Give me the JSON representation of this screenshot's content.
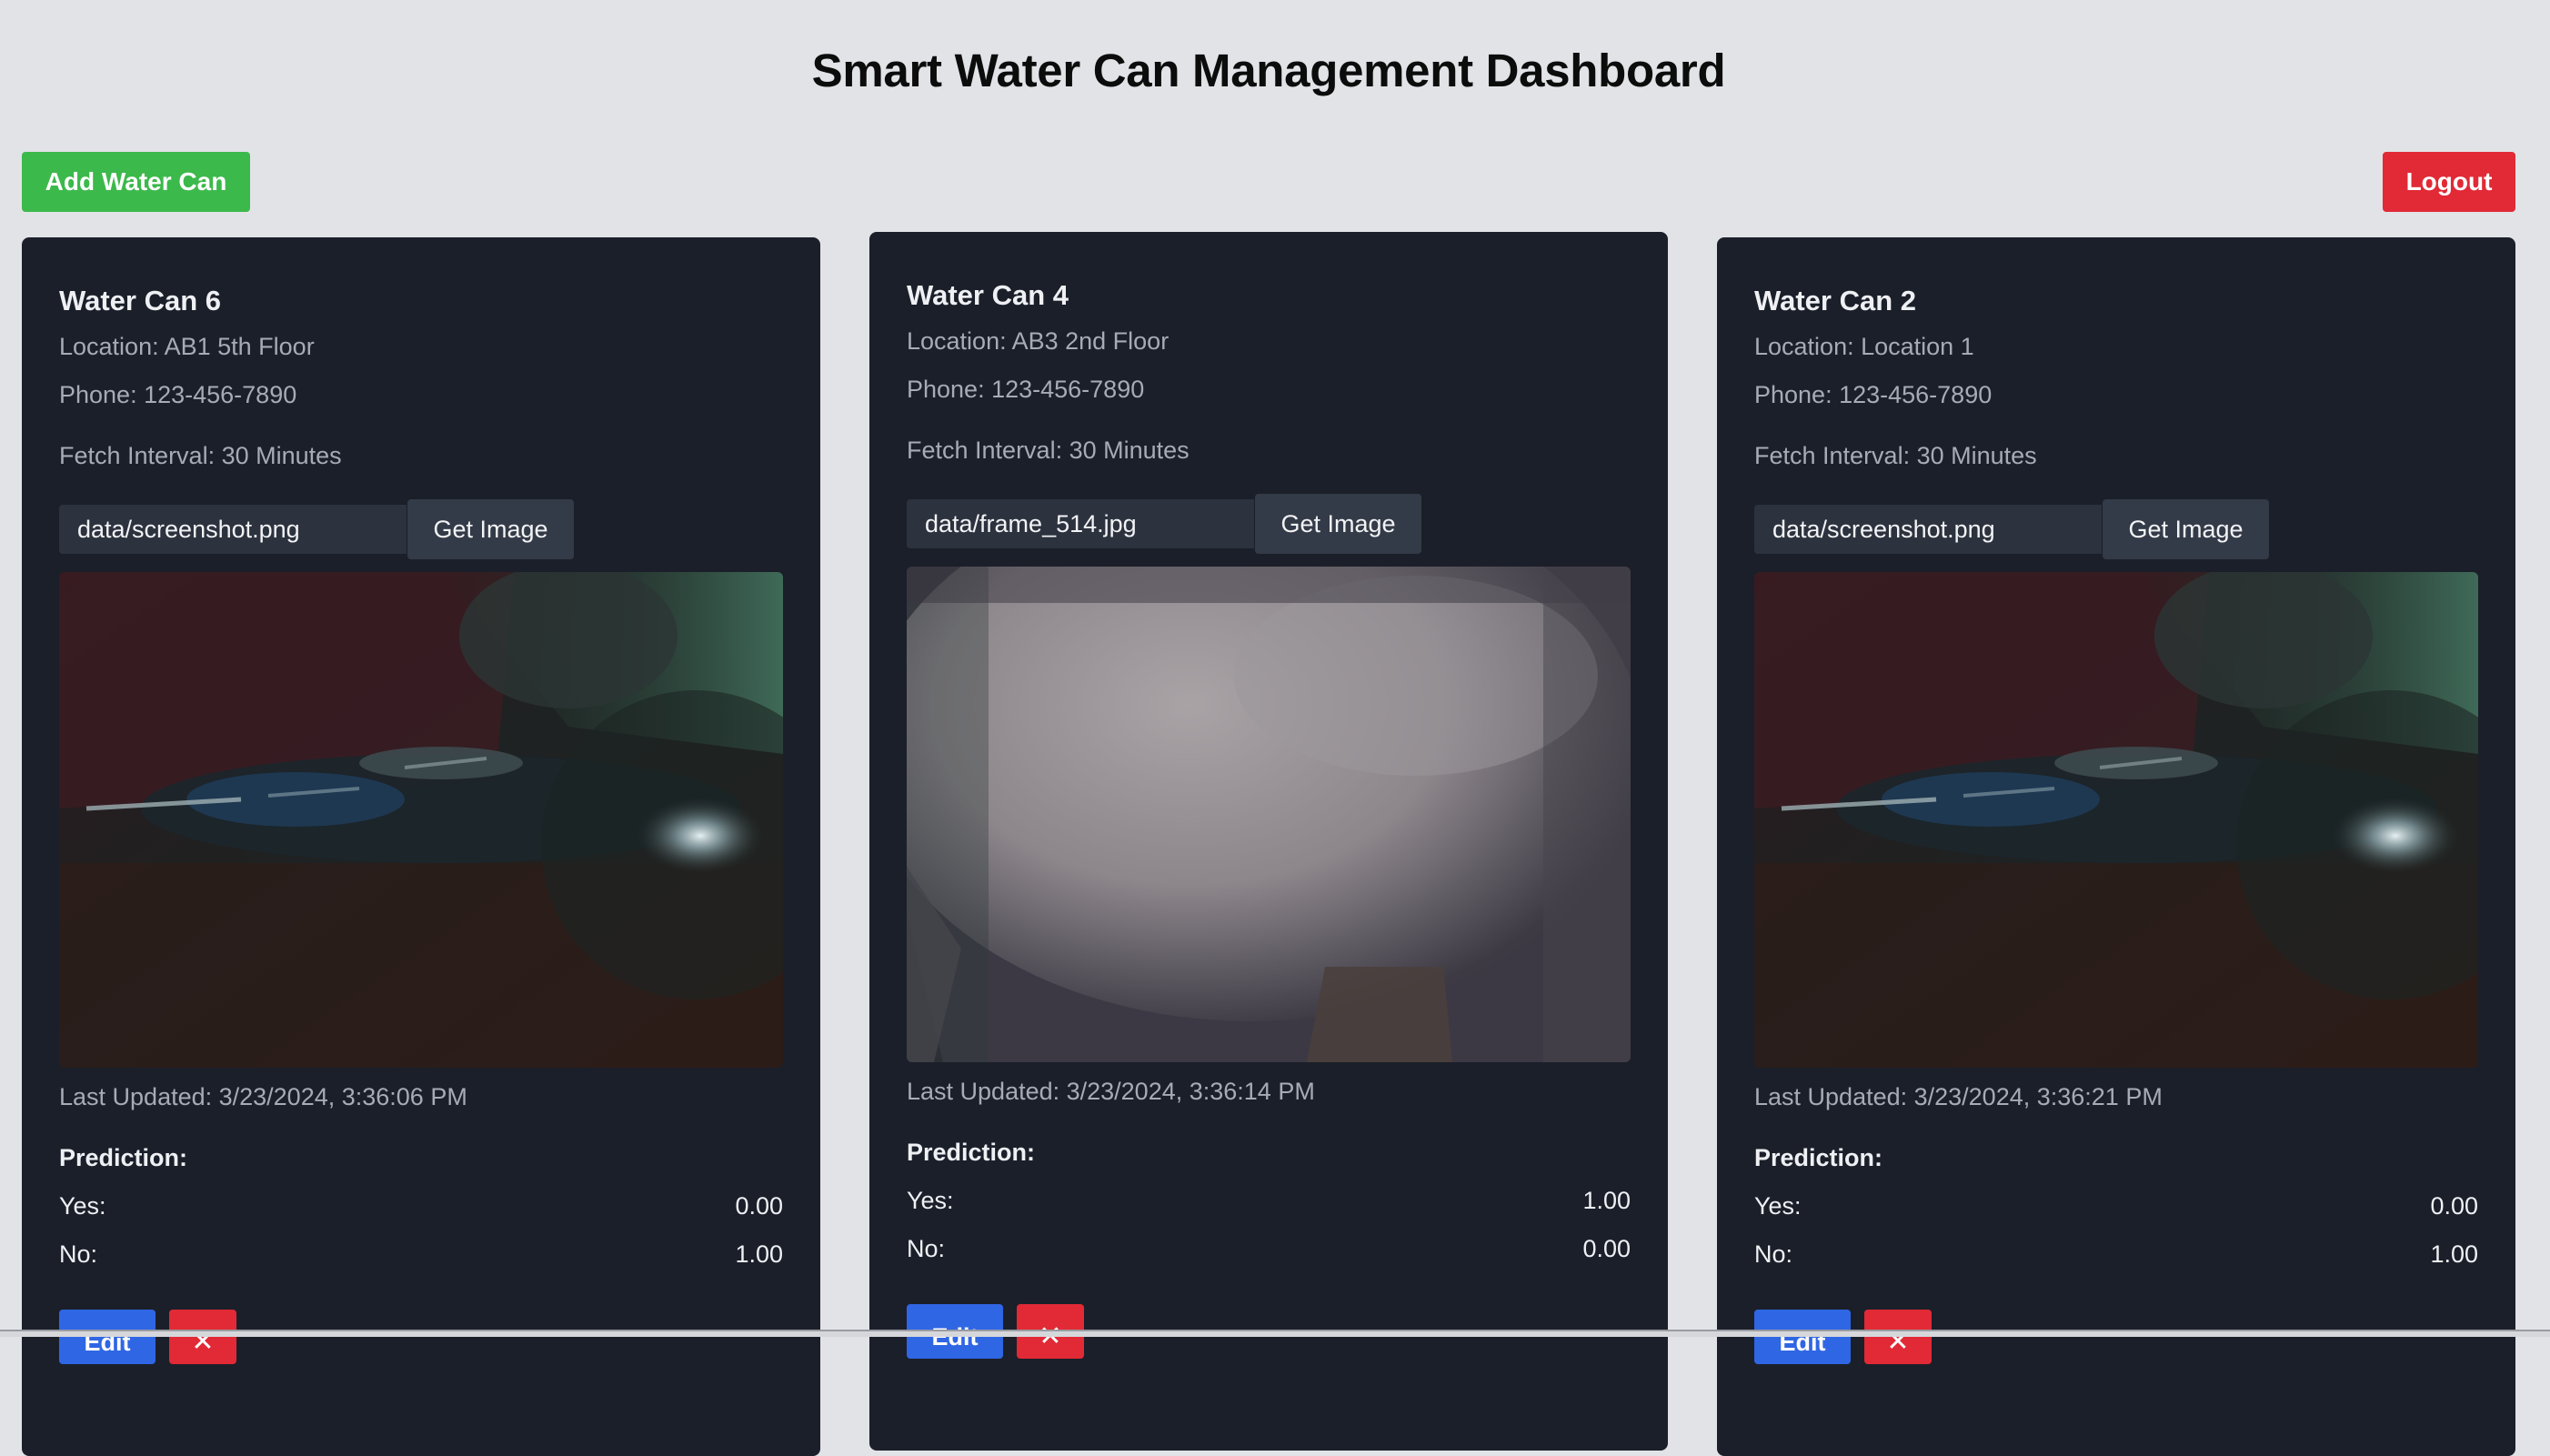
{
  "header": {
    "title": "Smart Water Can Management Dashboard",
    "add_label": "Add Water Can",
    "logout_label": "Logout"
  },
  "colors": {
    "page_bg": "#e2e3e7",
    "card_bg": "#1b1f29",
    "add_button": "#3cb94b",
    "logout_button": "#e12a36",
    "edit_button": "#2f66e4",
    "delete_button": "#e12a36"
  },
  "cards": [
    {
      "name": "Water Can 6",
      "location": "Location: AB1 5th Floor",
      "phone": "Phone: 123-456-7890",
      "interval": "Fetch Interval: 30 Minutes",
      "image_path": "data/screenshot.png",
      "get_image_label": "Get Image",
      "image_icon": "dark-camera-frame",
      "last_updated": "Last Updated: 3/23/2024, 3:36:06 PM",
      "prediction_label": "Prediction:",
      "yes_label": "Yes:",
      "yes_value": "0.00",
      "no_label": "No:",
      "no_value": "1.00",
      "edit_label": "Edit",
      "delete_label": "✕"
    },
    {
      "name": "Water Can 4",
      "location": "Location: AB3 2nd Floor",
      "phone": "Phone: 123-456-7890",
      "interval": "Fetch Interval: 30 Minutes",
      "image_path": "data/frame_514.jpg",
      "get_image_label": "Get Image",
      "image_icon": "bright-camera-frame",
      "last_updated": "Last Updated: 3/23/2024, 3:36:14 PM",
      "prediction_label": "Prediction:",
      "yes_label": "Yes:",
      "yes_value": "1.00",
      "no_label": "No:",
      "no_value": "0.00",
      "edit_label": "Edit",
      "delete_label": "✕"
    },
    {
      "name": "Water Can 2",
      "location": "Location: Location 1",
      "phone": "Phone: 123-456-7890",
      "interval": "Fetch Interval: 30 Minutes",
      "image_path": "data/screenshot.png",
      "get_image_label": "Get Image",
      "image_icon": "dark-camera-frame",
      "last_updated": "Last Updated: 3/23/2024, 3:36:21 PM",
      "prediction_label": "Prediction:",
      "yes_label": "Yes:",
      "yes_value": "0.00",
      "no_label": "No:",
      "no_value": "1.00",
      "edit_label": "Edit",
      "delete_label": "✕"
    }
  ]
}
